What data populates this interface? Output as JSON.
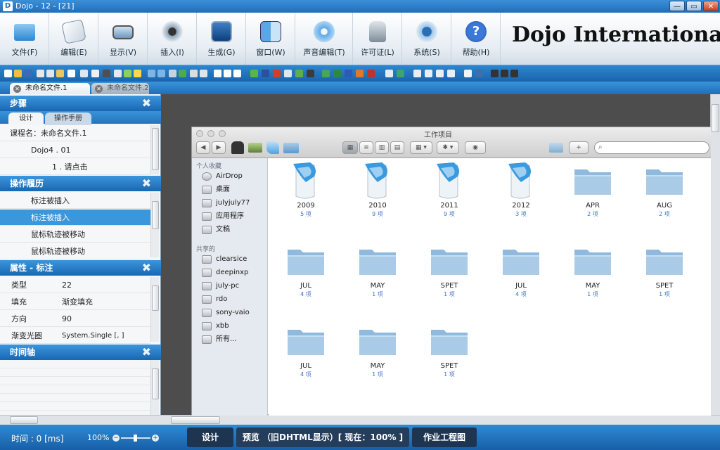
{
  "window": {
    "title": "Dojo - 12 - [21]",
    "minimize": "—",
    "restore": "▭",
    "close": "✕"
  },
  "ribbon": {
    "buttons": [
      {
        "label": "文件(F)",
        "icon": "folder-icon"
      },
      {
        "label": "编辑(E)",
        "icon": "edit-icon"
      },
      {
        "label": "显示(V)",
        "icon": "laptop-icon"
      },
      {
        "label": "插入(I)",
        "icon": "webcam-icon"
      },
      {
        "label": "生成(G)",
        "icon": "film-icon"
      },
      {
        "label": "窗口(W)",
        "icon": "finder-icon"
      },
      {
        "label": "声音编辑(T)",
        "icon": "music-icon"
      },
      {
        "label": "许可证(L)",
        "icon": "lock-icon"
      },
      {
        "label": "系统(S)",
        "icon": "gear-icon"
      },
      {
        "label": "帮助(H)",
        "icon": "help-icon"
      }
    ],
    "logo": "Dojo International"
  },
  "doc_tabs": [
    "未命名文件.1",
    "未命名文件.2"
  ],
  "panels": {
    "steps": {
      "title": "步骤",
      "subtabs": [
        "设计",
        "操作手册"
      ],
      "rows": [
        "课程名：未命名文件.1",
        "Dojo4 . 01",
        "1 . 请点击"
      ]
    },
    "history": {
      "title": "操作履历",
      "rows": [
        "标注被插入",
        "标注被插入",
        "鼠标轨迹被移动",
        "鼠标轨迹被移动"
      ]
    },
    "properties": {
      "title": "属性 - 标注",
      "rows": [
        {
          "key": "类型",
          "value": "22"
        },
        {
          "key": "填充",
          "value": "渐变填充"
        },
        {
          "key": "方向",
          "value": "90"
        },
        {
          "key": "渐变光圈",
          "value": "System.Single [, ]"
        }
      ]
    },
    "timeline": {
      "title": "时间轴"
    }
  },
  "finder": {
    "title": "工作项目",
    "search_placeholder": "",
    "sidebar": {
      "favorites_header": "个人收藏",
      "favorites": [
        "AirDrop",
        "桌面",
        "julyjuly77",
        "应用程序",
        "文稿"
      ],
      "shared_header": "共享的",
      "shared": [
        "clearsice",
        "deepinxp",
        "july-pc",
        "rdo",
        "sony-vaio",
        "xbb",
        "所有..."
      ]
    },
    "items": [
      {
        "name": "2009",
        "count": "5 项",
        "kind": "special"
      },
      {
        "name": "2010",
        "count": "9 项",
        "kind": "special"
      },
      {
        "name": "2011",
        "count": "9 项",
        "kind": "special"
      },
      {
        "name": "2012",
        "count": "3 项",
        "kind": "special"
      },
      {
        "name": "APR",
        "count": "2 项",
        "kind": "folder"
      },
      {
        "name": "AUG",
        "count": "2 项",
        "kind": "folder"
      },
      {
        "name": "JUL",
        "count": "4 项",
        "kind": "folder"
      },
      {
        "name": "MAY",
        "count": "1 项",
        "kind": "folder"
      },
      {
        "name": "SPET",
        "count": "1 项",
        "kind": "folder"
      },
      {
        "name": "JUL",
        "count": "4 项",
        "kind": "folder"
      },
      {
        "name": "MAY",
        "count": "1 项",
        "kind": "folder"
      },
      {
        "name": "SPET",
        "count": "1 项",
        "kind": "folder"
      },
      {
        "name": "JUL",
        "count": "4 项",
        "kind": "folder"
      },
      {
        "name": "MAY",
        "count": "1 项",
        "kind": "folder"
      },
      {
        "name": "SPET",
        "count": "1 项",
        "kind": "folder"
      }
    ]
  },
  "status": {
    "time": "时间 : 0 [ms]",
    "zoom": "100%",
    "zoom_out": "−",
    "zoom_in": "+",
    "modes": [
      "设计",
      "预览 （旧DHTML显示）[ 现在：100% ]",
      "作业工程图"
    ]
  },
  "colors": {
    "accent": "#1d6fbd",
    "selected": "#3a97dc",
    "folder": "#8fb9dd"
  }
}
